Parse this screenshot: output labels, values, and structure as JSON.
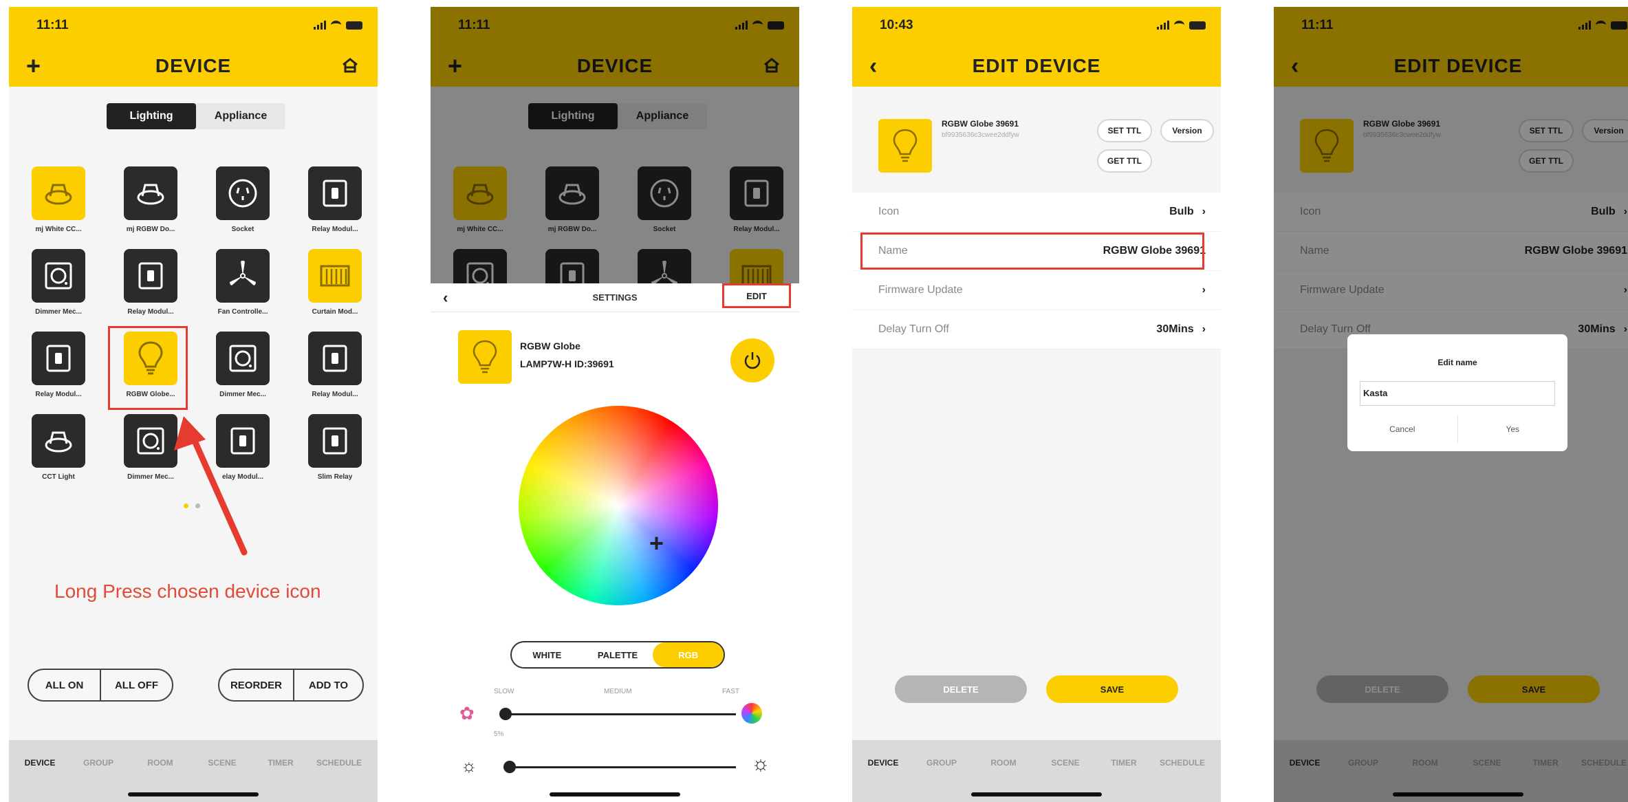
{
  "colors": {
    "accent": "#fcce00",
    "dark": "#2b2b2b",
    "highlight": "#e53c2f"
  },
  "screen1": {
    "time": "11:11",
    "title": "DEVICE",
    "add_icon": "+",
    "tabs": [
      "Lighting",
      "Appliance"
    ],
    "devices": [
      {
        "label": "mj White CC...",
        "icon": "downlight-icon",
        "yellow": true
      },
      {
        "label": "mj RGBW Do...",
        "icon": "downlight-icon",
        "yellow": false
      },
      {
        "label": "Socket",
        "icon": "socket-icon",
        "yellow": false
      },
      {
        "label": "Relay Modul...",
        "icon": "switch-icon",
        "yellow": false
      },
      {
        "label": "Dimmer Mec...",
        "icon": "dimmer-icon",
        "yellow": false
      },
      {
        "label": "Relay Modul...",
        "icon": "switch-icon",
        "yellow": false
      },
      {
        "label": "Fan Controlle...",
        "icon": "fan-icon",
        "yellow": false
      },
      {
        "label": "Curtain Mod...",
        "icon": "curtain-icon",
        "yellow": true
      },
      {
        "label": "Relay Modul...",
        "icon": "switch-icon",
        "yellow": false
      },
      {
        "label": "RGBW Globe...",
        "icon": "bulb-icon",
        "yellow": true
      },
      {
        "label": "Dimmer Mec...",
        "icon": "dimmer-icon",
        "yellow": false
      },
      {
        "label": "Relay Modul...",
        "icon": "switch-icon",
        "yellow": false
      },
      {
        "label": "CCT Light",
        "icon": "downlight-icon",
        "yellow": false
      },
      {
        "label": "Dimmer Mec...",
        "icon": "dimmer-icon",
        "yellow": false
      },
      {
        "label": "elay Modul...",
        "icon": "switch-icon",
        "yellow": false
      },
      {
        "label": "Slim Relay",
        "icon": "switch-icon",
        "yellow": false
      }
    ],
    "instruction": "Long Press chosen device icon",
    "btn_all_on": "ALL ON",
    "btn_all_off": "ALL OFF",
    "btn_reorder": "REORDER",
    "btn_add_to": "ADD TO",
    "bottom_tabs": [
      "DEVICE",
      "GROUP",
      "ROOM",
      "SCENE",
      "TIMER",
      "SCHEDULE"
    ]
  },
  "screen2": {
    "time": "11:11",
    "title": "DEVICE",
    "tabs": [
      "Lighting",
      "Appliance"
    ],
    "bg_labels": [
      "mj White CC...",
      "mj RGBW Do...",
      "Socket",
      "Relay Modul..."
    ],
    "settings_title": "SETTINGS",
    "edit_label": "EDIT",
    "device_name": "RGBW Globe",
    "device_model": "LAMP7W-H  ID:39691",
    "modes": [
      "WHITE",
      "PALETTE",
      "RGB"
    ],
    "speed_labels": [
      "SLOW",
      "MEDIUM",
      "FAST"
    ],
    "brightness_label": "5%"
  },
  "screen3": {
    "time": "10:43",
    "title": "EDIT DEVICE",
    "device_name": "RGBW Globe 39691",
    "device_id": "bf9935636c3cwee2ddfyw",
    "btn_set_ttl": "SET TTL",
    "btn_version": "Version",
    "btn_get_ttl": "GET TTL",
    "rows": [
      {
        "key": "Icon",
        "value": "Bulb"
      },
      {
        "key": "Name",
        "value": "RGBW Globe 39691"
      },
      {
        "key": "Firmware Update",
        "value": ""
      },
      {
        "key": "Delay Turn Off",
        "value": "30Mins"
      }
    ],
    "btn_delete": "DELETE",
    "btn_save": "SAVE",
    "bottom_tabs": [
      "DEVICE",
      "GROUP",
      "ROOM",
      "SCENE",
      "TIMER",
      "SCHEDULE"
    ]
  },
  "screen4": {
    "time": "11:11",
    "title": "EDIT DEVICE",
    "device_name": "RGBW Globe 39691",
    "device_id": "bf9935636c3cwee2ddfyw",
    "btn_set_ttl": "SET TTL",
    "btn_version": "Version",
    "btn_get_ttl": "GET TTL",
    "rows": [
      {
        "key": "Icon",
        "value": "Bulb"
      },
      {
        "key": "Name",
        "value": "RGBW Globe 39691"
      },
      {
        "key": "Firmware Update",
        "value": ""
      },
      {
        "key": "Delay Turn Off",
        "value": "30Mins"
      }
    ],
    "dialog_title": "Edit name",
    "dialog_input": "Kasta",
    "dialog_cancel": "Cancel",
    "dialog_yes": "Yes",
    "btn_delete": "DELETE",
    "btn_save": "SAVE",
    "bottom_tabs": [
      "DEVICE",
      "GROUP",
      "ROOM",
      "SCENE",
      "TIMER",
      "SCHEDULE"
    ]
  }
}
